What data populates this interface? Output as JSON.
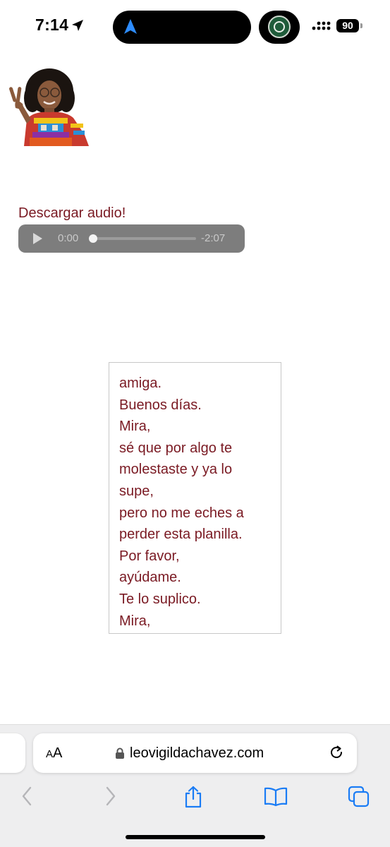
{
  "status_bar": {
    "time": "7:14",
    "battery": "90"
  },
  "page": {
    "download_link": "Descargar audio!",
    "audio_player": {
      "current_time": "0:00",
      "remaining_time": "-2:07",
      "progress": 0.0
    },
    "transcript_lines": [
      "amiga.",
      "Buenos días.",
      "Mira,",
      "sé que por algo te",
      "molestaste y ya lo",
      "supe,",
      "pero no me eches a",
      "perder esta planilla.",
      "Por favor,",
      "ayúdame.",
      "Te lo suplico.",
      "Mira,"
    ]
  },
  "browser": {
    "text_size_small": "A",
    "text_size_large": "A",
    "url": "leovigildachavez.com",
    "toolbar_icons": [
      "back-icon",
      "forward-icon",
      "share-icon",
      "bookmarks-icon",
      "tabs-icon"
    ],
    "accent_color": "#1a7cf5"
  },
  "colors": {
    "link_text": "#7a1a23",
    "player_bg": "#7d7d7d"
  }
}
